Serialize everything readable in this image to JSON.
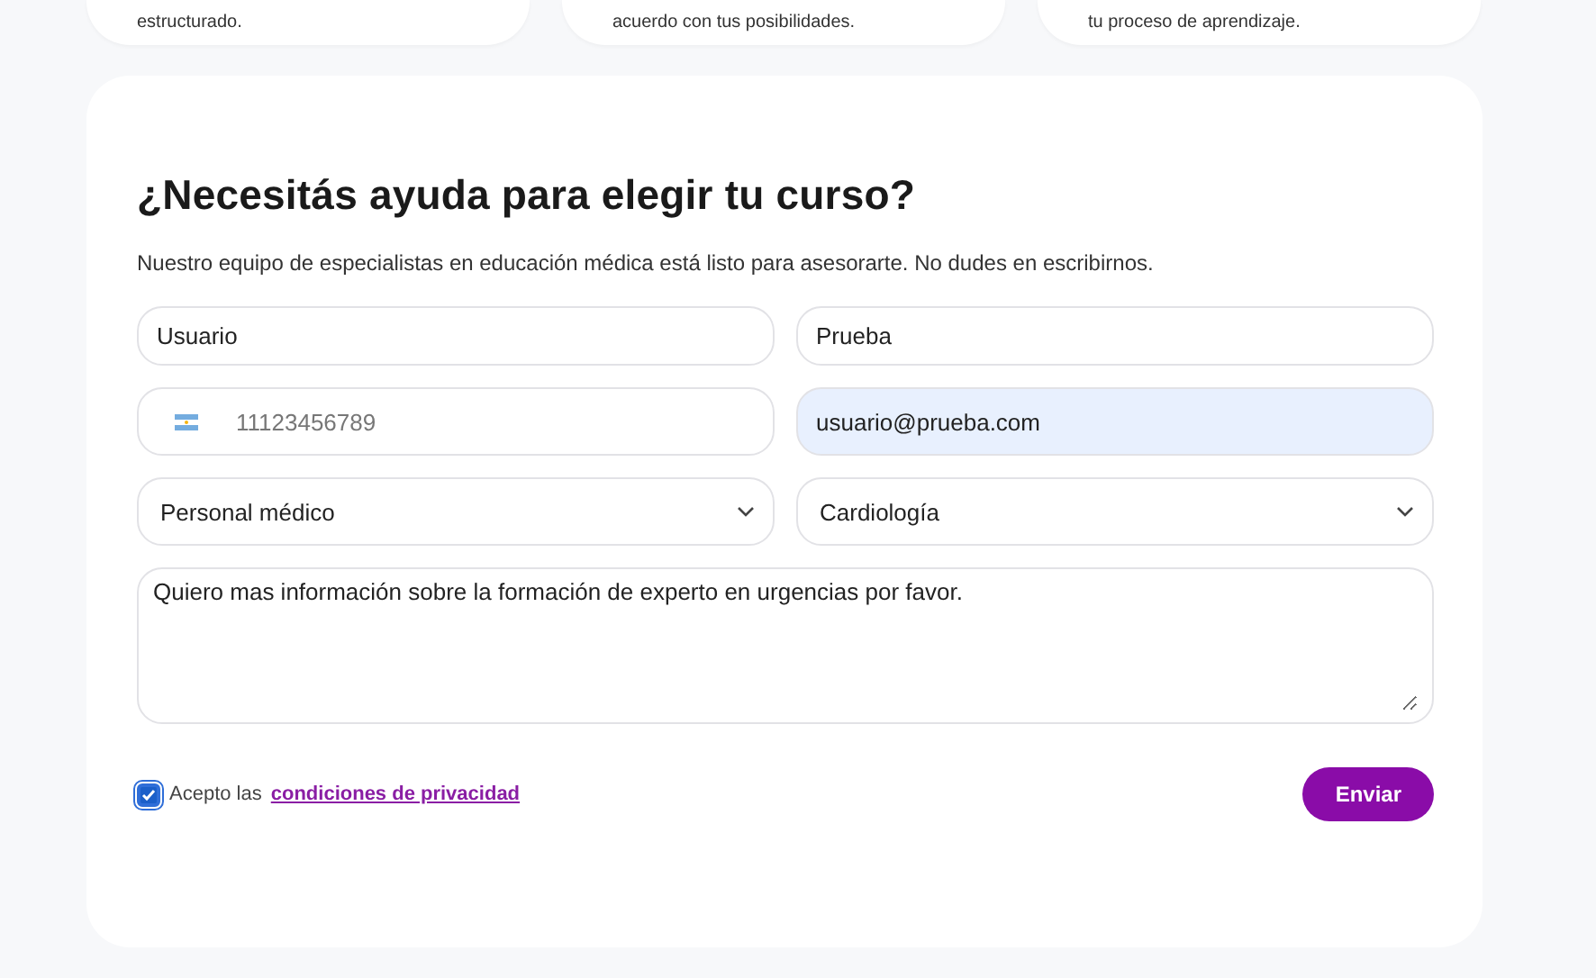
{
  "top_cards": [
    {
      "text": "estructurado."
    },
    {
      "text": "acuerdo con tus posibilidades."
    },
    {
      "text": "tu proceso de aprendizaje."
    }
  ],
  "form": {
    "title": "¿Necesitás ayuda para elegir tu curso?",
    "description": "Nuestro equipo de especialistas en educación médica está listo para asesorarte. No dudes en escribirnos.",
    "first_name": {
      "value": "Usuario"
    },
    "last_name": {
      "value": "Prueba"
    },
    "phone": {
      "placeholder": "11123456789"
    },
    "email": {
      "value": "usuario@prueba.com",
      "autofilled": true
    },
    "profession": {
      "value": "Personal médico"
    },
    "specialty": {
      "value": "Cardiología"
    },
    "message": {
      "value": "Quiero mas información sobre la formación de experto en urgencias por favor."
    },
    "consent": {
      "text": "Acepto las",
      "link": "condiciones de privacidad",
      "checked": true
    },
    "submit": "Enviar"
  }
}
